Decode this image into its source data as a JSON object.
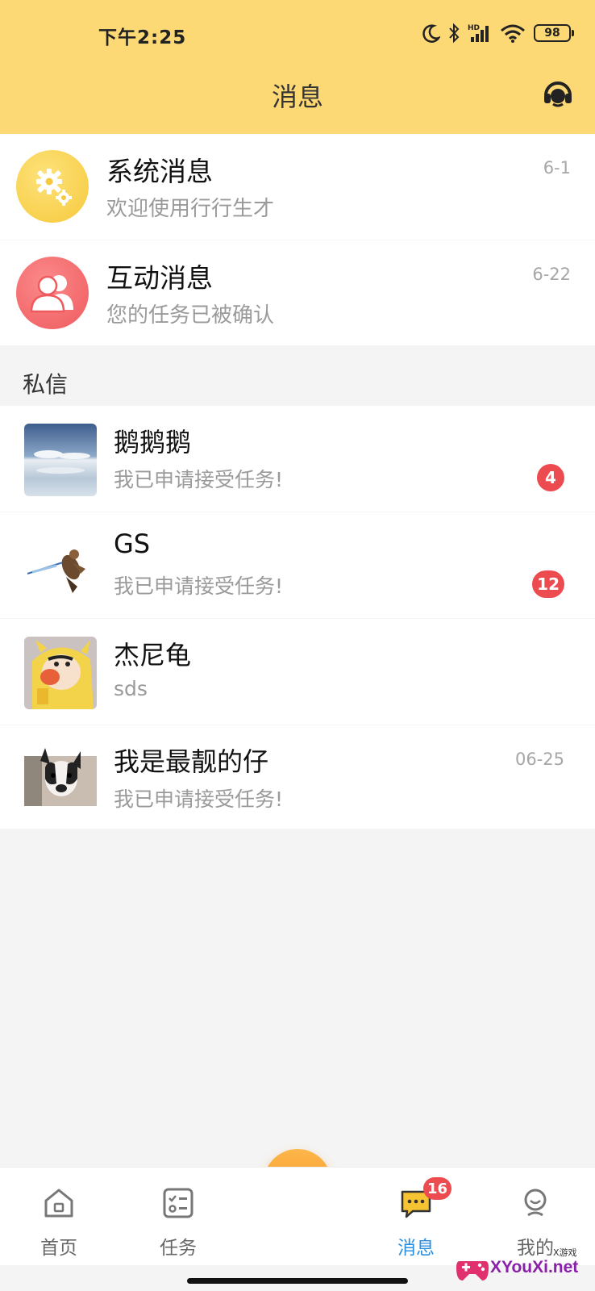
{
  "status_bar": {
    "time": "下午2:25",
    "battery": "98"
  },
  "header": {
    "title": "消息",
    "support_icon": "headset-icon"
  },
  "system_messages": [
    {
      "title": "系统消息",
      "subtitle": "欢迎使用行行生才",
      "time": "6-1",
      "icon": "gear-icon",
      "color": "#f6c93c"
    },
    {
      "title": "互动消息",
      "subtitle": "您的任务已被确认",
      "time": "6-22",
      "icon": "people-icon",
      "color": "#ef5a5e"
    }
  ],
  "private_section": {
    "label": "私信"
  },
  "private_messages": [
    {
      "name": "鹅鹅鹅",
      "message": "我已申请接受任务!",
      "badge": "4"
    },
    {
      "name": "GS",
      "message": "我已申请接受任务!",
      "badge": "12"
    },
    {
      "name": "杰尼龟",
      "message": "sds"
    },
    {
      "name": "我是最靓的仔",
      "message": "我已申请接受任务!",
      "time": "06-25"
    }
  ],
  "tabbar": {
    "tabs": [
      {
        "label": "首页",
        "icon": "home-icon"
      },
      {
        "label": "任务",
        "icon": "task-list-icon"
      },
      {
        "label": "消息",
        "icon": "message-icon",
        "badge": "16",
        "active": true
      },
      {
        "label": "我的",
        "icon": "profile-icon"
      }
    ],
    "add_icon": "plus-icon"
  },
  "watermark": {
    "brand": "XYouXi.net",
    "small": "X游戏"
  },
  "colors": {
    "header_bg": "#fdd976",
    "accent_tab": "#2b8fe0",
    "badge": "#ec4b4f",
    "add_button": "#f88f1d"
  }
}
